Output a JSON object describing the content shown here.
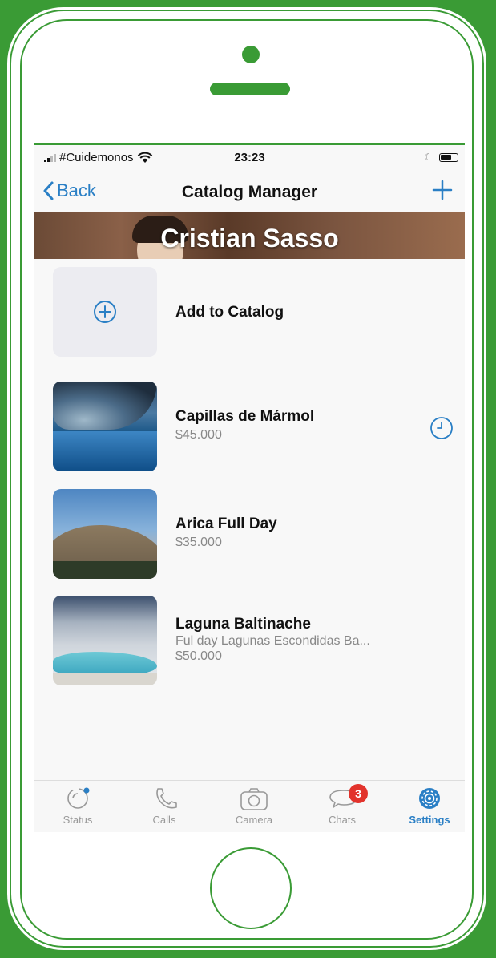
{
  "status_bar": {
    "carrier": "#Cuidemonos",
    "time": "23:23"
  },
  "nav": {
    "back_label": "Back",
    "title": "Catalog Manager"
  },
  "banner": {
    "name": "Cristian Sasso"
  },
  "catalog": {
    "add_label": "Add to Catalog",
    "items": [
      {
        "title": "Capillas de Mármol",
        "price": "$45.000"
      },
      {
        "title": "Arica Full Day",
        "price": "$35.000"
      },
      {
        "title": "Laguna Baltinache",
        "description": "Ful day Lagunas Escondidas Ba...",
        "price": "$50.000"
      }
    ]
  },
  "tabs": [
    {
      "label": "Status"
    },
    {
      "label": "Calls"
    },
    {
      "label": "Camera"
    },
    {
      "label": "Chats",
      "badge": "3"
    },
    {
      "label": "Settings"
    }
  ],
  "colors": {
    "accent": "#2a7fc5",
    "frame_green": "#3a9b35",
    "badge": "#e2332c"
  }
}
